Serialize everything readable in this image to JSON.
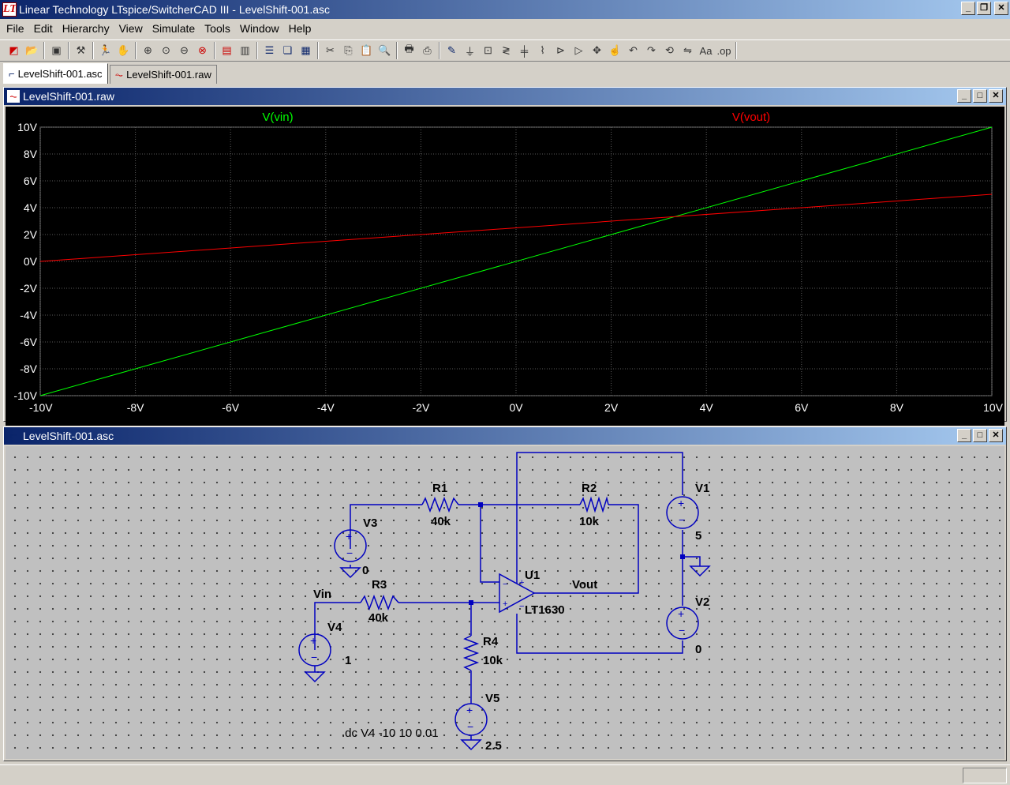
{
  "app": {
    "title": "Linear Technology LTspice/SwitcherCAD III - LevelShift-001.asc",
    "icon": "ltspice-logo-icon"
  },
  "menu": [
    "File",
    "Edit",
    "Hierarchy",
    "View",
    "Simulate",
    "Tools",
    "Window",
    "Help"
  ],
  "tabs": [
    {
      "label": "LevelShift-001.asc",
      "icon": "schematic-icon",
      "active": true
    },
    {
      "label": "LevelShift-001.raw",
      "icon": "waveform-icon",
      "active": false
    }
  ],
  "plot_window": {
    "title": "LevelShift-001.raw"
  },
  "schematic_window": {
    "title": "LevelShift-001.asc"
  },
  "chart_data": {
    "type": "line",
    "x": [
      -10,
      10
    ],
    "series": [
      {
        "name": "V(vin)",
        "color": "#00ff00",
        "values": [
          -10,
          10
        ]
      },
      {
        "name": "V(vout)",
        "color": "#ff0000",
        "values": [
          0,
          5
        ]
      }
    ],
    "xlim": [
      -10,
      10
    ],
    "ylim": [
      -10,
      10
    ],
    "xticks": [
      "-10V",
      "-8V",
      "-6V",
      "-4V",
      "-2V",
      "0V",
      "2V",
      "4V",
      "6V",
      "8V",
      "10V"
    ],
    "yticks": [
      "10V",
      "8V",
      "6V",
      "4V",
      "2V",
      "0V",
      "-2V",
      "-4V",
      "-6V",
      "-8V",
      "-10V"
    ],
    "grid": true,
    "background": "#000000"
  },
  "schematic": {
    "components": {
      "R1": {
        "name": "R1",
        "value": "40k"
      },
      "R2": {
        "name": "R2",
        "value": "10k"
      },
      "R3": {
        "name": "R3",
        "value": "40k"
      },
      "R4": {
        "name": "R4",
        "value": "10k"
      },
      "V1": {
        "name": "V1",
        "value": "5"
      },
      "V2": {
        "name": "V2",
        "value": "0"
      },
      "V3": {
        "name": "V3",
        "value": "0"
      },
      "V4": {
        "name": "V4",
        "value": "1"
      },
      "V5": {
        "name": "V5",
        "value": "2.5"
      },
      "U1": {
        "name": "U1",
        "value": "LT1630"
      }
    },
    "net_labels": {
      "vin": "Vin",
      "vout": "Vout"
    },
    "directive": ".dc V4 -10 10 0.01",
    "wire_color": "#0000c0"
  }
}
